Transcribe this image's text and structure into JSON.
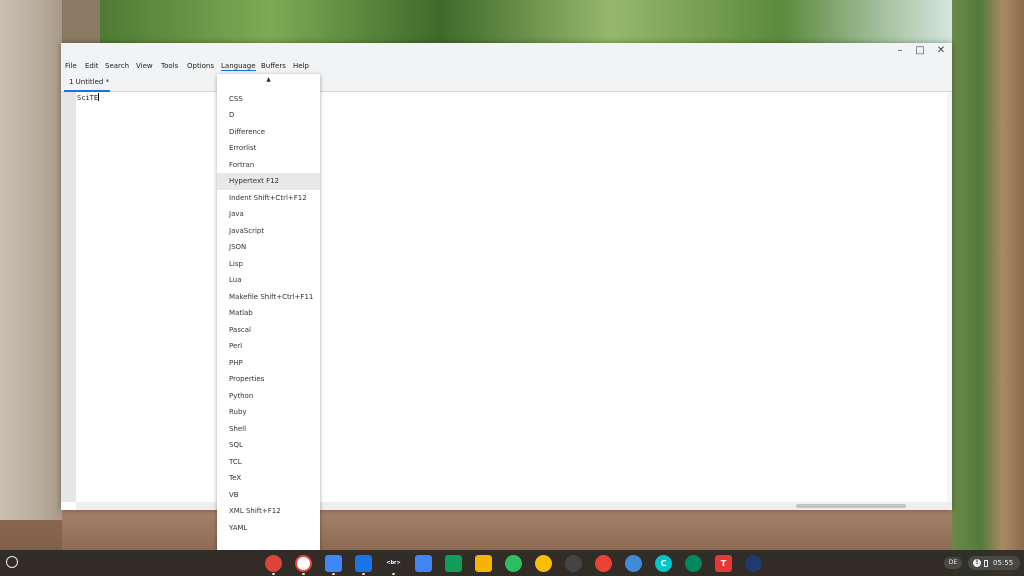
{
  "menubar": {
    "items": [
      "File",
      "Edit",
      "Search",
      "View",
      "Tools",
      "Options",
      "Language",
      "Buffers",
      "Help"
    ]
  },
  "window_controls": {
    "minimize": "–",
    "maximize": "□",
    "close": "✕"
  },
  "tabs": [
    {
      "label": "1 Untitled *"
    }
  ],
  "editor": {
    "text": "SciTE"
  },
  "language_menu": {
    "scroll_up": "▲",
    "highlighted": "Hypertext F12",
    "items": [
      "CSS",
      "D",
      "Difference",
      "Errorlist",
      "Fortran",
      "Hypertext F12",
      "Indent Shift+Ctrl+F12",
      "Java",
      "JavaScript",
      "JSON",
      "Lisp",
      "Lua",
      "Makefile Shift+Ctrl+F11",
      "Matlab",
      "Pascal",
      "Perl",
      "PHP",
      "Properties",
      "Python",
      "Ruby",
      "Shell",
      "SQL",
      "TCL",
      "TeX",
      "VB",
      "XML Shift+F12",
      "YAML"
    ]
  },
  "shelf": {
    "apps": [
      {
        "name": "chrome-icon",
        "color": "#db4437"
      },
      {
        "name": "gmail-icon",
        "color": "#ffffff"
      },
      {
        "name": "calendar-icon",
        "color": "#4285f4"
      },
      {
        "name": "files-icon",
        "color": "#1a73e8"
      },
      {
        "name": "terminal-icon",
        "color": "#2d2d2d"
      },
      {
        "name": "docs-icon",
        "color": "#4285f4"
      },
      {
        "name": "sheets-icon",
        "color": "#0f9d58"
      },
      {
        "name": "slides-icon",
        "color": "#f4b400"
      },
      {
        "name": "evernote-icon",
        "color": "#2dbe60"
      },
      {
        "name": "keep-icon",
        "color": "#fbbc04"
      },
      {
        "name": "tux-icon",
        "color": "#444444"
      },
      {
        "name": "photos-icon",
        "color": "#ea4335"
      },
      {
        "name": "vscode-icon",
        "color": "#3c8dd6"
      },
      {
        "name": "canva-icon",
        "color": "#00c4cc"
      },
      {
        "name": "play-store-icon",
        "color": "#01875f"
      },
      {
        "name": "text-app-icon",
        "color": "#e53935"
      },
      {
        "name": "globe-icon",
        "color": "#1e3a6e"
      }
    ],
    "terminal_glyph": "<br>",
    "text_app_glyph": "T",
    "canva_glyph": "C",
    "ime": "DE",
    "time": "05:55",
    "info_glyph": "!"
  }
}
